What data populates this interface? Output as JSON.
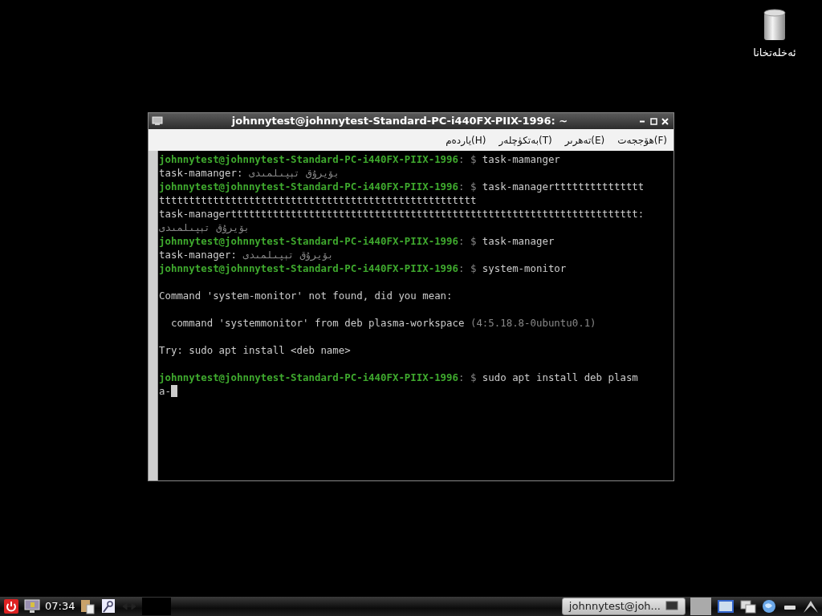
{
  "desktop_icons": [
    {
      "label": "ئەخلەتخانا"
    }
  ],
  "window": {
    "title": "johnnytest@johnnytest-Standard-PC-i440FX-PIIX-1996: ~"
  },
  "menu": [
    {
      "label": "ھۆججەت(F)"
    },
    {
      "label": "تەھرىر(E)"
    },
    {
      "label": "بەتكۈچلەر(T)"
    },
    {
      "label": "ياردەم(H)"
    }
  ],
  "terminal_lines": [
    [
      {
        "kind": "prompt",
        "text": "johnnytest@johnnytest-Standard-PC-i440FX-PIIX-1996"
      },
      {
        "kind": "dim",
        "text": ": $ "
      },
      {
        "kind": "text",
        "text": "task-mamanger"
      }
    ],
    [
      {
        "kind": "text",
        "text": "task-mamanger: "
      },
      {
        "kind": "dim",
        "text": "بۆيرۇق تېپىلمىدى"
      }
    ],
    [
      {
        "kind": "prompt",
        "text": "johnnytest@johnnytest-Standard-PC-i440FX-PIIX-1996"
      },
      {
        "kind": "dim",
        "text": ": $ "
      },
      {
        "kind": "text",
        "text": "task-managerttttttttttttttt"
      }
    ],
    [
      {
        "kind": "text",
        "text": "ttttttttttttttttttttttttttttttttttttttttttttttttttttt"
      }
    ],
    [
      {
        "kind": "text",
        "text": "task-managertttttttttttttttttttttttttttttttttttttttttttttttttttttttttttttttttttt:"
      }
    ],
    [
      {
        "kind": "dim",
        "text": "بۆيرۇق تېپىلمىدى"
      }
    ],
    [
      {
        "kind": "prompt",
        "text": "johnnytest@johnnytest-Standard-PC-i440FX-PIIX-1996"
      },
      {
        "kind": "dim",
        "text": ": $ "
      },
      {
        "kind": "text",
        "text": "task-manager"
      }
    ],
    [
      {
        "kind": "text",
        "text": "task-manager: "
      },
      {
        "kind": "dim",
        "text": "بۆيرۇق تېپىلمىدى"
      }
    ],
    [
      {
        "kind": "prompt",
        "text": "johnnytest@johnnytest-Standard-PC-i440FX-PIIX-1996"
      },
      {
        "kind": "dim",
        "text": ": $ "
      },
      {
        "kind": "text",
        "text": "system-monitor"
      }
    ],
    {
      "kind": "blank"
    },
    [
      {
        "kind": "text",
        "text": "Command 'system-monitor' not found, did you mean:"
      }
    ],
    {
      "kind": "blank"
    },
    [
      {
        "kind": "text",
        "text": "  command 'systemmonitor' from deb plasma-workspace "
      },
      {
        "kind": "dim",
        "text": "(4:5.18.8-0ubuntu0.1)"
      }
    ],
    {
      "kind": "blank"
    },
    [
      {
        "kind": "text",
        "text": "Try: sudo apt install <deb name>"
      }
    ],
    {
      "kind": "blank"
    },
    [
      {
        "kind": "prompt",
        "text": "johnnytest@johnnytest-Standard-PC-i440FX-PIIX-1996"
      },
      {
        "kind": "dim",
        "text": ": $ "
      },
      {
        "kind": "text",
        "text": "sudo apt install deb plasm"
      }
    ],
    [
      {
        "kind": "text",
        "text": "a-"
      },
      {
        "kind": "cursor"
      }
    ]
  ],
  "taskbar": {
    "clock": "07:34",
    "tasks": [
      {
        "label": "johnnytest@joh...",
        "selected": true
      }
    ]
  }
}
